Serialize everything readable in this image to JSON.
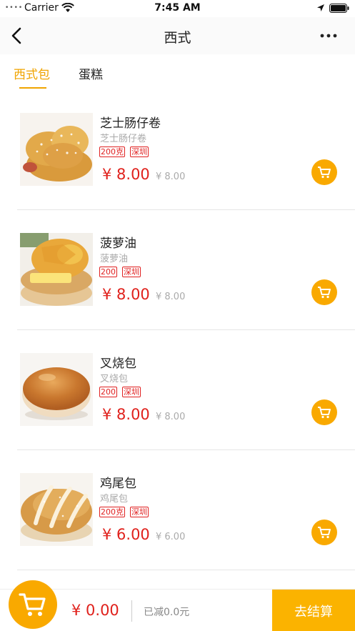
{
  "status_bar": {
    "signal": "••••",
    "carrier": "Carrier",
    "time": "7:45 AM"
  },
  "nav": {
    "title": "西式"
  },
  "tabs": [
    {
      "label": "西式包",
      "active": true
    },
    {
      "label": "蛋糕",
      "active": false
    }
  ],
  "products": [
    {
      "name": "芝士肠仔卷",
      "subtitle": "芝士肠仔卷",
      "tags": [
        "200克",
        "深圳"
      ],
      "price": "¥ 8.00",
      "original_price": "¥ 8.00",
      "image": "sausage-roll"
    },
    {
      "name": "菠萝油",
      "subtitle": "菠萝油",
      "tags": [
        "200",
        "深圳"
      ],
      "price": "¥ 8.00",
      "original_price": "¥ 8.00",
      "image": "pineapple-bun"
    },
    {
      "name": "叉烧包",
      "subtitle": "叉烧包",
      "tags": [
        "200",
        "深圳"
      ],
      "price": "¥ 8.00",
      "original_price": "¥ 8.00",
      "image": "bbq-pork-bun"
    },
    {
      "name": "鸡尾包",
      "subtitle": "鸡尾包",
      "tags": [
        "200克",
        "深圳"
      ],
      "price": "¥ 6.00",
      "original_price": "¥ 6.00",
      "image": "cocktail-bun"
    }
  ],
  "bottom_bar": {
    "total": "¥ 0.00",
    "discount": "已减0.0元",
    "checkout_label": "去结算"
  },
  "colors": {
    "accent": "#f9a900",
    "price_red": "#e0211c",
    "tag_red": "#e02020"
  }
}
